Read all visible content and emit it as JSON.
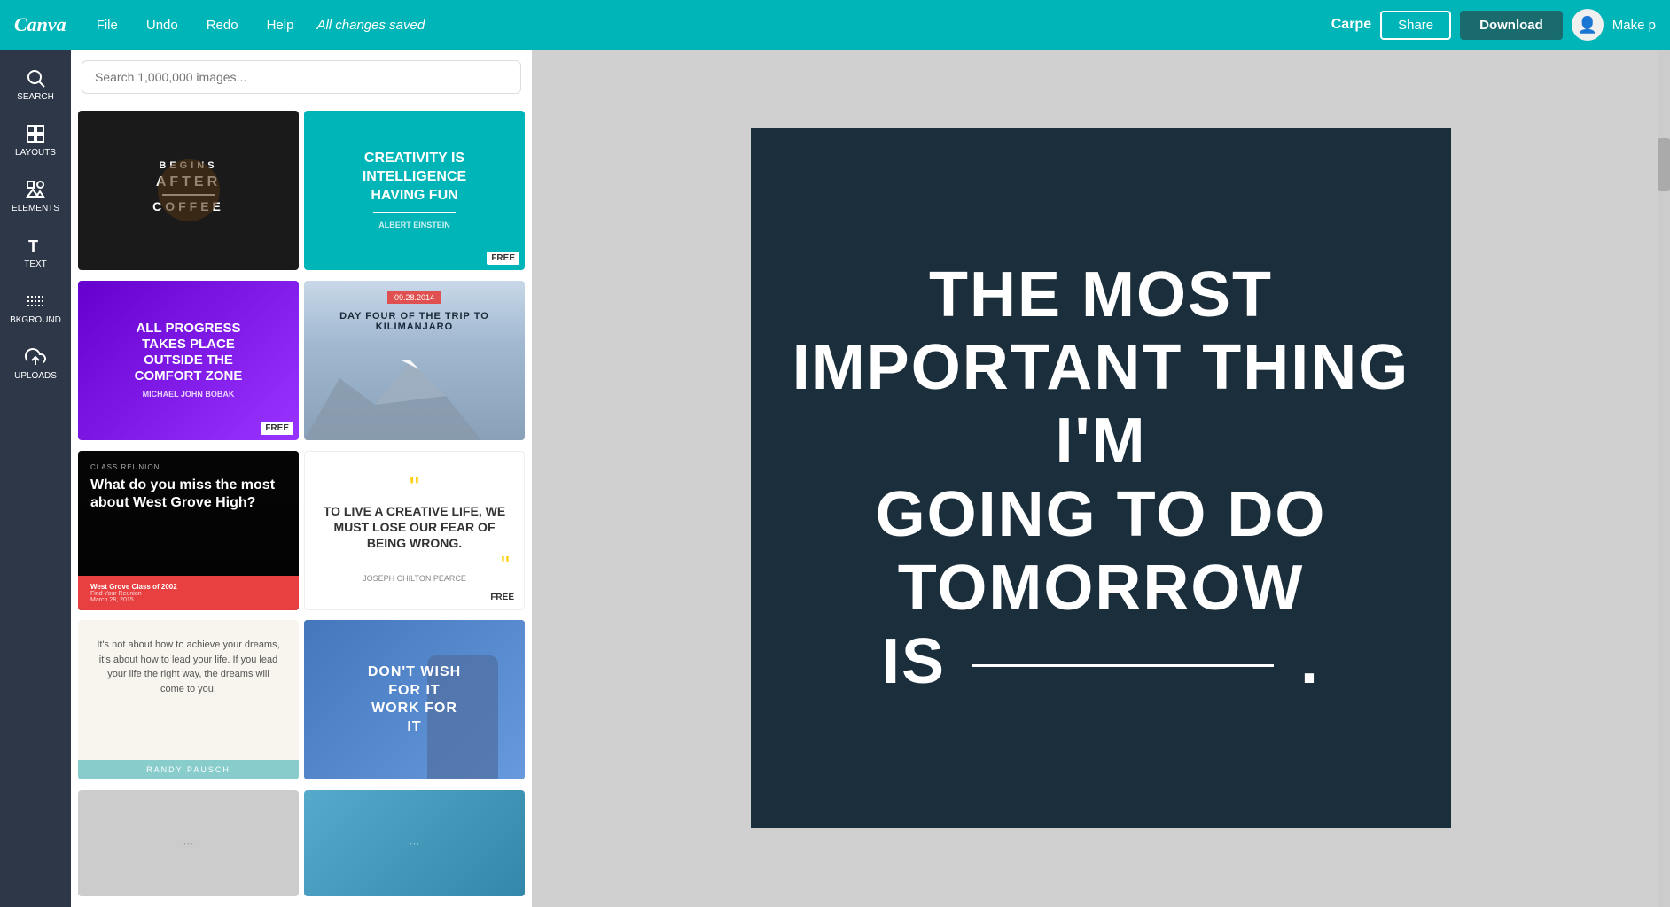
{
  "topnav": {
    "logo": "Canva",
    "menu": {
      "file": "File",
      "undo": "Undo",
      "redo": "Redo",
      "help": "Help"
    },
    "status": "All changes saved",
    "project_name": "Carpe",
    "share_label": "Share",
    "download_label": "Download",
    "make_label": "Make p"
  },
  "sidebar": {
    "items": [
      {
        "id": "search",
        "label": "SEARCH"
      },
      {
        "id": "layouts",
        "label": "LAYOUTS"
      },
      {
        "id": "elements",
        "label": "ELEMENTS"
      },
      {
        "id": "text",
        "label": "TEXT"
      },
      {
        "id": "background",
        "label": "BKGROUND"
      },
      {
        "id": "uploads",
        "label": "UPLOADS"
      }
    ]
  },
  "panel": {
    "search_placeholder": "Search 1,000,000 images...",
    "templates": [
      {
        "id": "t1",
        "lines": [
          "BEGINS",
          "AFTER",
          "COFFEE"
        ],
        "sub": ""
      },
      {
        "id": "t2",
        "lines": [
          "CREATIVITY IS",
          "INTELLIGENCE",
          "HAVING FUN"
        ],
        "sub": "ALBERT EINSTEIN",
        "badge": "FREE"
      },
      {
        "id": "t3",
        "lines": [
          "ALL PROGRESS",
          "TAKES PLACE",
          "OUTSIDE THE",
          "COMFORT ZONE"
        ],
        "sub": "Michael John Bobak",
        "badge": "FREE"
      },
      {
        "id": "t4",
        "date": "09.28.2014",
        "title": "DAY FOUR OF THE TRIP TO\nKILIMANJARO"
      },
      {
        "id": "t5",
        "question": "What do you miss the most about West Grove High?",
        "class": "West Grove Class of 2002",
        "footer": "Find Your Reunion\nMarch 28, 2015"
      },
      {
        "id": "t6",
        "quote": "“”",
        "text": "TO LIVE A CREATIVE LIFE, WE MUST LOSE OUR FEAR OF BEING WRONG.",
        "sub": "JOSEPH CHILTON PEARCE",
        "badge": "FREE"
      },
      {
        "id": "t7",
        "text": "It's not about how to achieve your dreams, it's about how to lead your life. If you lead your life the right way, the dreams will come to you.",
        "author": "RANDY PAUSCH"
      },
      {
        "id": "t8",
        "text": "DON'T WISH FOR IT\nWORK FOR IT"
      }
    ]
  },
  "canvas": {
    "line1": "THE MOST",
    "line2": "IMPORTANT THING I'M",
    "line3": "GOING TO DO",
    "line4": "TOMORROW",
    "line5": "IS",
    "line6": "."
  }
}
